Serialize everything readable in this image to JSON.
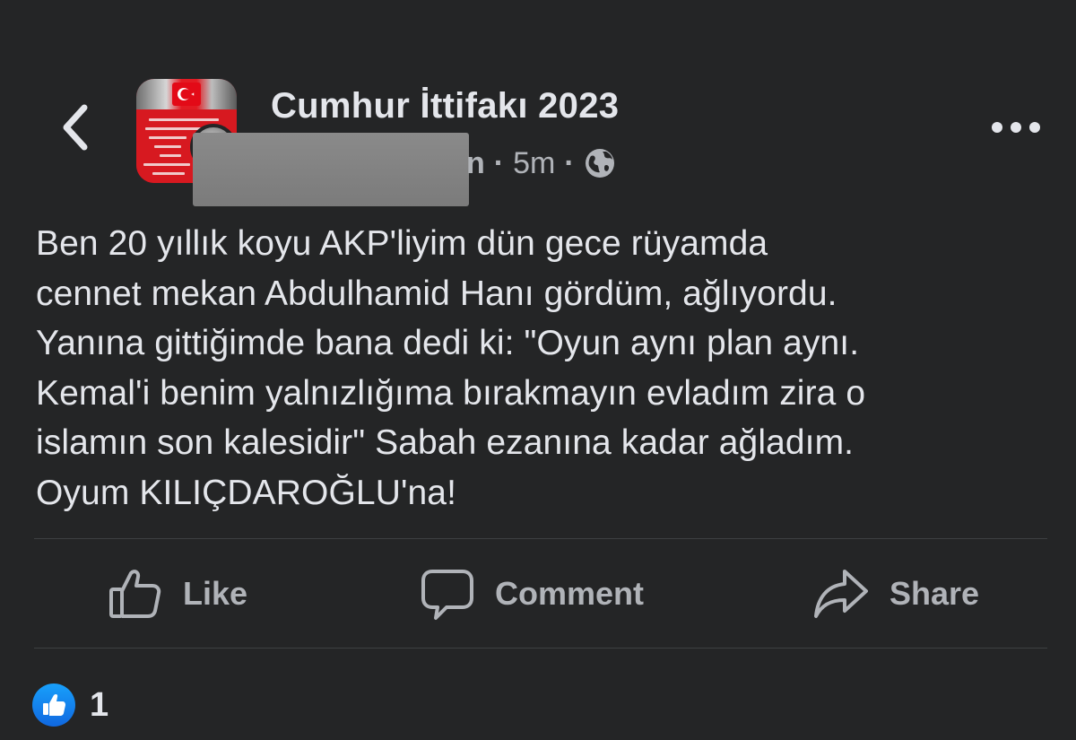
{
  "header": {
    "page_name": "Cumhur İttifakı 2023",
    "author_visible_tail": "n",
    "separator": "·",
    "timestamp": "5m",
    "audience_icon": "globe-icon",
    "back_icon": "chevron-left-icon",
    "more_icon": "more-dots-icon"
  },
  "post": {
    "text": "Ben 20 yıllık koyu AKP'liyim dün gece rüyamda\ncennet mekan Abdulhamid Hanı gördüm, ağlıyordu.\nYanına gittiğimde bana dedi ki: \"Oyun aynı plan aynı.\nKemal'i benim yalnızlığıma bırakmayın evladım zira o\nislamın son kalesidir\" Sabah ezanına kadar ağladım.\nOyum KILIÇDAROĞLU'na!"
  },
  "actions": {
    "like_label": "Like",
    "comment_label": "Comment",
    "share_label": "Share"
  },
  "reactions": {
    "icon": "like-thumb-icon",
    "count": "1"
  },
  "colors": {
    "background": "#242526",
    "primary_text": "#e4e6eb",
    "secondary_text": "#b0b3b8",
    "like_blue": "#1877f2",
    "divider": "#3e4042"
  }
}
